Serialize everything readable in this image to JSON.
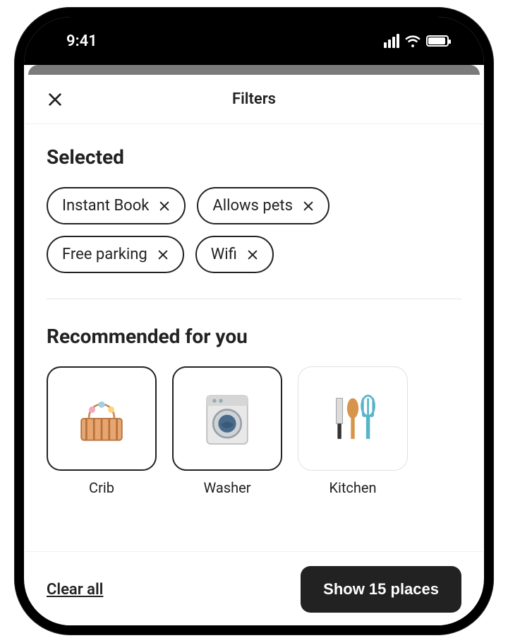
{
  "status": {
    "time": "9:41"
  },
  "header": {
    "title": "Filters"
  },
  "selected": {
    "title": "Selected",
    "chips": [
      {
        "label": "Instant Book"
      },
      {
        "label": "Allows pets"
      },
      {
        "label": "Free parking"
      },
      {
        "label": "Wifi"
      }
    ]
  },
  "recommended": {
    "title": "Recommended for you",
    "cards": [
      {
        "label": "Crib",
        "selected": true,
        "icon": "crib"
      },
      {
        "label": "Washer",
        "selected": true,
        "icon": "washer"
      },
      {
        "label": "Kitchen",
        "selected": false,
        "icon": "kitchen"
      }
    ]
  },
  "footer": {
    "clear_label": "Clear all",
    "show_label": "Show 15 places"
  }
}
